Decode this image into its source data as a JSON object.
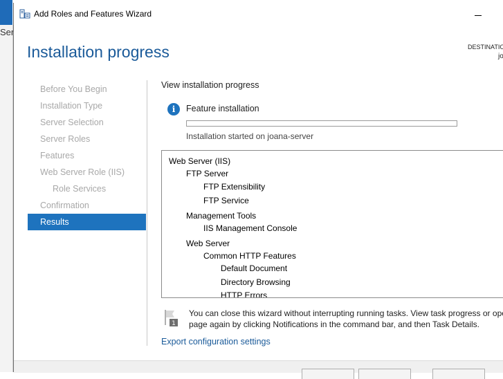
{
  "background": {
    "partial_text": "Ser"
  },
  "window": {
    "title": "Add Roles and Features Wizard",
    "icon": "server-manager-icon",
    "minimize_icon": "minimize-icon"
  },
  "header": {
    "page_title": "Installation progress",
    "destination_label": "DESTINATIO",
    "destination_server": "jo"
  },
  "nav": {
    "items": [
      {
        "label": "Before You Begin",
        "state": "disabled"
      },
      {
        "label": "Installation Type",
        "state": "disabled"
      },
      {
        "label": "Server Selection",
        "state": "disabled"
      },
      {
        "label": "Server Roles",
        "state": "disabled"
      },
      {
        "label": "Features",
        "state": "disabled"
      },
      {
        "label": "Web Server Role (IIS)",
        "state": "disabled"
      },
      {
        "label": "Role Services",
        "state": "disabled",
        "sub": true
      },
      {
        "label": "Confirmation",
        "state": "disabled"
      },
      {
        "label": "Results",
        "state": "active"
      }
    ]
  },
  "main": {
    "view_label": "View installation progress",
    "info_icon": "info-icon",
    "info_glyph": "i",
    "feature_label": "Feature installation",
    "progress": 0,
    "status_text": "Installation started on joana-server",
    "results": [
      {
        "text": "Web Server (IIS)",
        "level": 0
      },
      {
        "text": "FTP Server",
        "level": 1
      },
      {
        "text": "FTP Extensibility",
        "level": 2
      },
      {
        "text": "FTP Service",
        "level": 2
      },
      {
        "text": "Management Tools",
        "level": 1
      },
      {
        "text": "IIS Management Console",
        "level": 2
      },
      {
        "text": "Web Server",
        "level": 1
      },
      {
        "text": "Common HTTP Features",
        "level": 2
      },
      {
        "text": "Default Document",
        "level": 3
      },
      {
        "text": "Directory Browsing",
        "level": 3
      },
      {
        "text": "HTTP Errors",
        "level": 3
      }
    ],
    "note_icon": "flag-notification-icon",
    "note_badge": "1",
    "note_text": "You can close this wizard without interrupting running tasks. View task progress or ope page again by clicking Notifications in the command bar, and then Task Details.",
    "export_link": "Export configuration settings"
  },
  "colors": {
    "accent": "#1e73be",
    "title_blue": "#1a5a99",
    "disabled_text": "#a8a8a8"
  }
}
